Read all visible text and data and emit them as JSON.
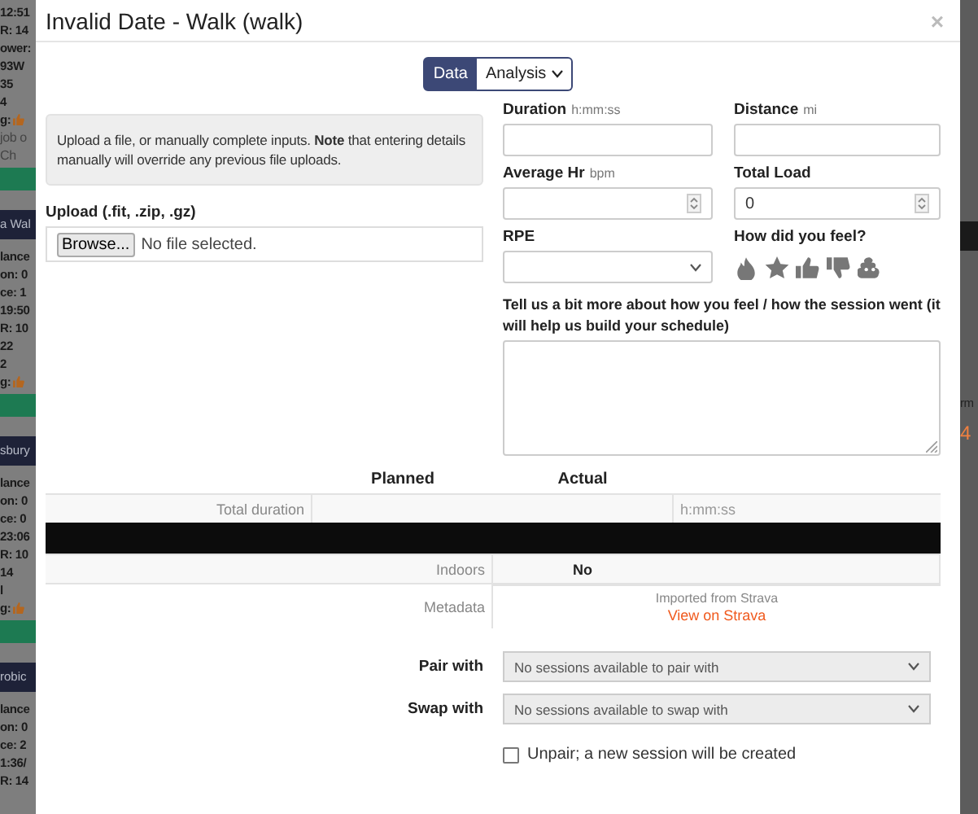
{
  "background": {
    "left": [
      {
        "kind": "text",
        "text": "12:51"
      },
      {
        "kind": "text",
        "text": "R: 14"
      },
      {
        "kind": "text",
        "text": "ower:"
      },
      {
        "kind": "text",
        "text": "93W"
      },
      {
        "kind": "text",
        "text": "35"
      },
      {
        "kind": "text",
        "text": "4"
      },
      {
        "kind": "rating",
        "text": "g:"
      },
      {
        "kind": "small",
        "text": "job o"
      },
      {
        "kind": "small",
        "text": "Ch"
      },
      {
        "kind": "band"
      },
      {
        "kind": "title",
        "text": "a Wal"
      },
      {
        "kind": "text",
        "text": "lance"
      },
      {
        "kind": "text",
        "text": "on: 0"
      },
      {
        "kind": "text",
        "text": "ce: 1"
      },
      {
        "kind": "text",
        "text": "19:50"
      },
      {
        "kind": "text",
        "text": "R: 10"
      },
      {
        "kind": "text",
        "text": "22"
      },
      {
        "kind": "text",
        "text": "2"
      },
      {
        "kind": "rating",
        "text": "g:"
      },
      {
        "kind": "band"
      },
      {
        "kind": "title",
        "text": "sbury"
      },
      {
        "kind": "text",
        "text": "lance"
      },
      {
        "kind": "text",
        "text": "on: 0"
      },
      {
        "kind": "text",
        "text": "ce: 0"
      },
      {
        "kind": "text",
        "text": "23:06"
      },
      {
        "kind": "text",
        "text": "R: 10"
      },
      {
        "kind": "text",
        "text": "14"
      },
      {
        "kind": "text",
        "text": "l"
      },
      {
        "kind": "rating",
        "text": "g:"
      },
      {
        "kind": "band"
      },
      {
        "kind": "title",
        "text": "robic"
      },
      {
        "kind": "text",
        "text": "lance"
      },
      {
        "kind": "text",
        "text": "on: 0"
      },
      {
        "kind": "text",
        "text": "ce: 2"
      },
      {
        "kind": "text",
        "text": "1:36/"
      },
      {
        "kind": "text",
        "text": "R: 14"
      }
    ],
    "right": [
      {
        "kind": "text",
        "text": "rm"
      },
      {
        "kind": "accent",
        "text": "4"
      }
    ]
  },
  "modal": {
    "title": "Invalid Date - Walk (walk)",
    "close": "×"
  },
  "view_toggle": [
    {
      "label": "Data",
      "selected": true,
      "kind": "button"
    },
    {
      "label": "Analysis",
      "selected": false,
      "kind": "dropdown"
    }
  ],
  "notice": "Upload a file, or manually complete inputs. **Note** that entering details manually will override any previous file uploads.",
  "upload": {
    "label": "Upload (.fit, .zip, .gz)",
    "button": "Browse...",
    "status": "No file selected."
  },
  "fields": [
    {
      "kind": "text",
      "label": "Duration",
      "unit": "h:mm:ss"
    },
    {
      "kind": "text",
      "label": "Distance",
      "unit": "mi"
    },
    {
      "kind": "number",
      "label": "Average Hr",
      "unit": "bpm"
    },
    {
      "kind": "number",
      "label": "Total Load",
      "value": "0"
    },
    {
      "kind": "select",
      "label": "RPE"
    },
    {
      "kind": "feel",
      "label": "How did you feel?"
    }
  ],
  "notes": {
    "label": "Tell us a bit more about how you feel / how the session went (it will help us build your schedule)"
  },
  "table": {
    "columns": [
      "Planned",
      "Actual"
    ],
    "rows": [
      {
        "kind": "duration",
        "label": "Total duration",
        "unit": "h:mm:ss"
      },
      {
        "kind": "bar"
      },
      {
        "kind": "value",
        "label": "Indoors",
        "value": "No"
      },
      {
        "kind": "link",
        "label": "Metadata",
        "note": "Imported from Strava",
        "link": "View on Strava"
      }
    ]
  },
  "pairing": [
    {
      "label": "Pair with",
      "value": "No sessions available to pair with"
    },
    {
      "label": "Swap with",
      "value": "No sessions available to swap with"
    }
  ],
  "unpair": {
    "label": "Unpair; a new session will be created",
    "checked": false
  }
}
